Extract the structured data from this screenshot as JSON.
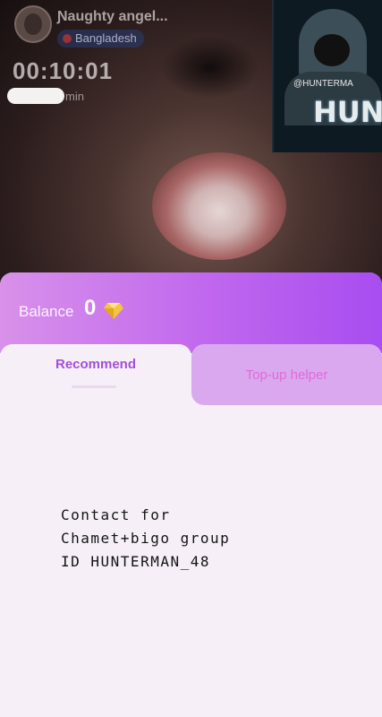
{
  "host": {
    "name": "Ɲaughty angel...",
    "country": "Bangladesh",
    "timer": "00:10:01",
    "duration_unit": "min"
  },
  "pip": {
    "handle": "@HUNTERMA",
    "brand": "HUNT"
  },
  "wallet": {
    "balance_label": "Balance",
    "balance_value": "0",
    "diamond_icon": "diamond-icon"
  },
  "tabs": [
    {
      "label": "Recommend",
      "active": true
    },
    {
      "label": "Top-up helper",
      "active": false
    }
  ],
  "overlay_text": {
    "line1": "Contact for",
    "line2": "Chamet+bigo group",
    "line3": "ID HUNTERMAN_48"
  },
  "colors": {
    "accent_purple": "#a84df0",
    "tab_active_text": "#a44fd8",
    "tab_inactive_bg": "#d9a8ef",
    "tab_inactive_text": "#e26ad9"
  }
}
